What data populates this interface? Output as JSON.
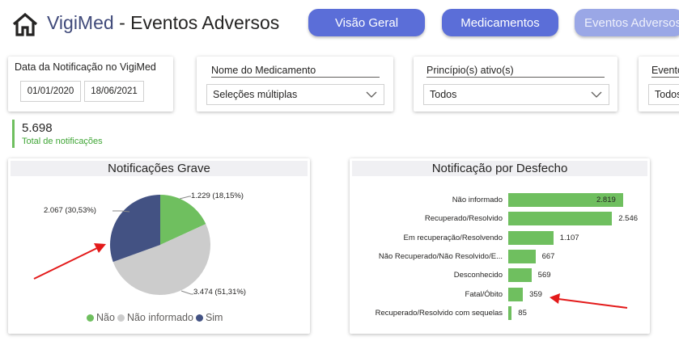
{
  "header": {
    "app_name": "VigiMed",
    "separator": " - ",
    "page_title": "Eventos Adversos",
    "nav": [
      {
        "label": "Visão Geral"
      },
      {
        "label": "Medicamentos"
      },
      {
        "label": "Eventos Adversos"
      }
    ]
  },
  "filters": {
    "date": {
      "label": "Data da Notificação no VigiMed",
      "start": "01/01/2020",
      "end": "18/06/2021"
    },
    "medicine": {
      "label": "Nome do Medicamento",
      "value": "Seleções múltiplas"
    },
    "active_ingredient": {
      "label": "Princípio(s) ativo(s)",
      "value": "Todos"
    },
    "event": {
      "label": "Evento",
      "value": "Todos"
    }
  },
  "kpi": {
    "value": "5.698",
    "label": "Total de notificações"
  },
  "pie_chart": {
    "title": "Notificações Grave",
    "labels": [
      "1.229 (18,15%)",
      "3.474 (51,31%)",
      "2.067 (30,53%)"
    ],
    "legend": [
      "Não",
      "Não informado",
      "Sim"
    ]
  },
  "bar_chart": {
    "title": "Notificação por Desfecho",
    "value_labels": [
      "2.819",
      "2.546",
      "1.107",
      "667",
      "569",
      "359",
      "85"
    ]
  },
  "colors": {
    "green": "#6fbf5f",
    "gray": "#cccccc",
    "navy": "#435283",
    "nav_button": "#5b6ed8",
    "arrow": "#e31a1a"
  },
  "chart_data": [
    {
      "type": "pie",
      "title": "Notificações Grave",
      "categories": [
        "Não",
        "Não informado",
        "Sim"
      ],
      "values": [
        1229,
        3474,
        2067
      ],
      "percentages": [
        18.15,
        51.31,
        30.53
      ],
      "colors": [
        "#6fbf5f",
        "#cccccc",
        "#435283"
      ],
      "legend": "bottom"
    },
    {
      "type": "bar",
      "orientation": "horizontal",
      "title": "Notificação por Desfecho",
      "categories": [
        "Não informado",
        "Recuperado/Resolvido",
        "Em recuperação/Resolvendo",
        "Não Recuperado/Não Resolvido/E...",
        "Desconhecido",
        "Fatal/Óbito",
        "Recuperado/Resolvido com sequelas"
      ],
      "values": [
        2819,
        2546,
        1107,
        667,
        569,
        359,
        85
      ],
      "color": "#6fbf5f"
    }
  ]
}
